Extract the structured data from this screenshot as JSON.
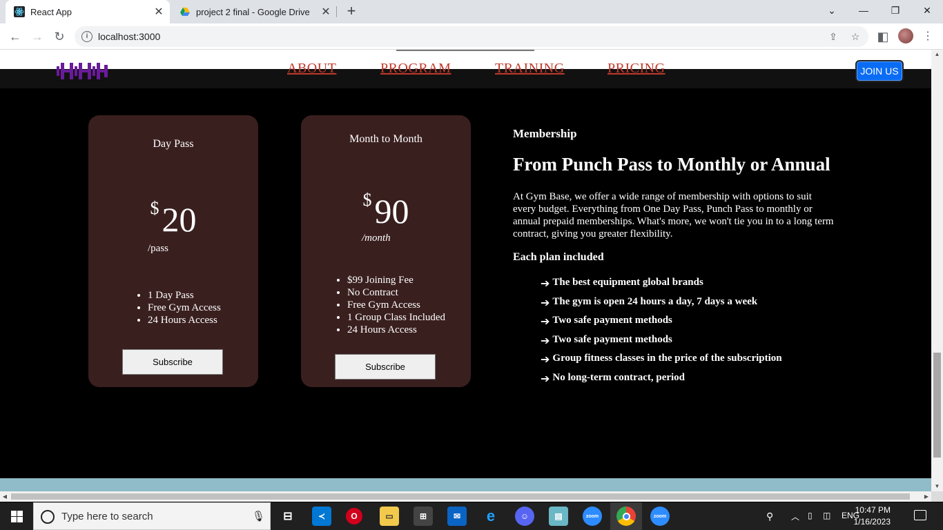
{
  "browser": {
    "tabs": [
      {
        "title": "React App",
        "active": true
      },
      {
        "title": "project 2 final - Google Drive",
        "active": false
      }
    ],
    "url": "localhost:3000"
  },
  "nav": {
    "links": [
      "ABOUT",
      "PROGRAM",
      "TRAINING",
      "PRICING"
    ],
    "join_label": "JOIN US"
  },
  "plans": [
    {
      "title": "Day Pass",
      "currency": "$",
      "price": "20",
      "period": "/pass",
      "features": [
        "1 Day Pass",
        "Free Gym Access",
        "24 Hours Access"
      ],
      "button": "Subscribe"
    },
    {
      "title": "Month to Month",
      "currency": "$",
      "price": "90",
      "period": "/month",
      "features": [
        "$99 Joining Fee",
        "No Contract",
        "Free Gym Access",
        "1 Group Class Included",
        "24 Hours Access"
      ],
      "button": "Subscribe"
    }
  ],
  "membership": {
    "kicker": "Membership",
    "headline": "From Punch Pass to Monthly or Annual",
    "body": "At Gym Base, we offer a wide range of membership with options to suit every budget. Everything from One Day Pass, Punch Pass to monthly or annual prepaid memberships. What's more, we won't tie you in to a long term contract, giving you greater flexibility.",
    "plan_heading": "Each plan included",
    "perks": [
      "The best equipment global brands",
      "The gym is open 24 hours a day, 7 days a week",
      "Two safe payment methods",
      "Two safe payment methods",
      "Group fitness classes in the price of the subscription",
      "No long-term contract, period"
    ]
  },
  "taskbar": {
    "search_placeholder": "Type here to search",
    "language": "ENG",
    "time": "10:47 PM",
    "date": "1/16/2023"
  },
  "colors": {
    "card_bg": "#3a1f1f",
    "nav_link": "#c0392b",
    "join_button": "#0a6cf5",
    "logo": "#6a1b9a",
    "footer_strip": "#8fbcc8"
  }
}
